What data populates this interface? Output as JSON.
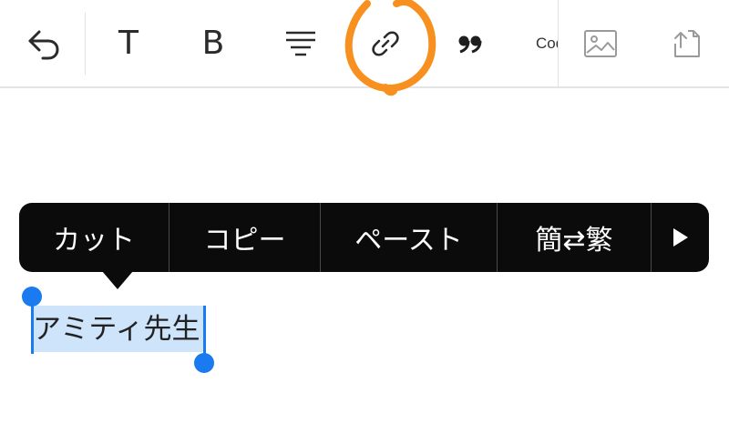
{
  "toolbar": {
    "text_label": "T",
    "bold_label": "B",
    "code_label": "Cod"
  },
  "context_menu": {
    "cut": "カット",
    "copy": "コピー",
    "paste": "ペースト",
    "convert": "簡⇄繁"
  },
  "editor": {
    "selected_text": "アミティ先生"
  },
  "colors": {
    "annotation": "#f7901e",
    "selection": "#cde4fb",
    "handle": "#1a7bf0",
    "menu_background": "#0b0b0b"
  },
  "icons": [
    "undo-icon",
    "text-style-icon",
    "bold-icon",
    "align-icon",
    "link-icon",
    "quote-icon",
    "image-icon",
    "export-icon",
    "more-arrow-icon"
  ]
}
